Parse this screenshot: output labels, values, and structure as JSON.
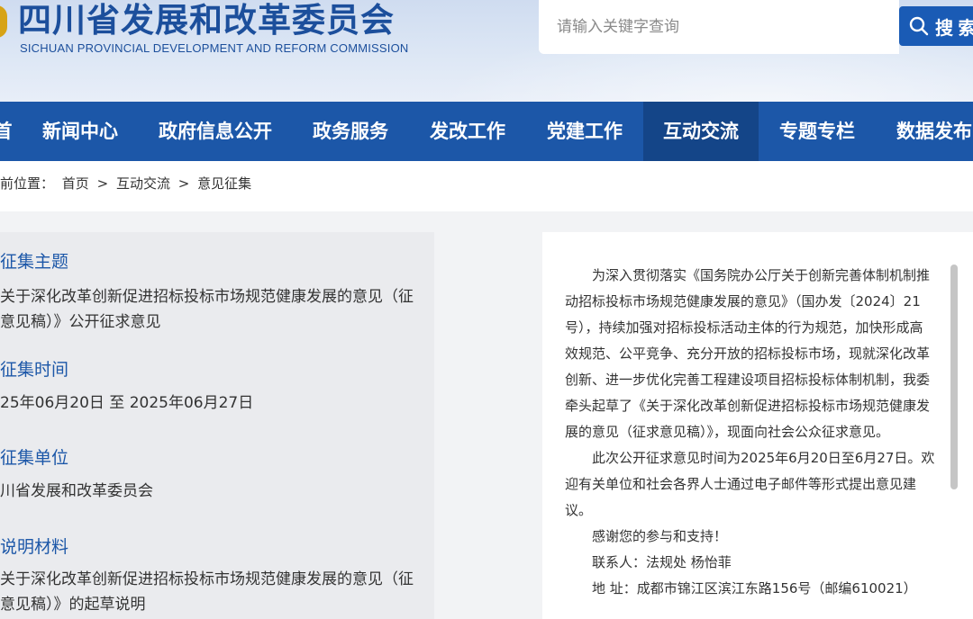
{
  "header": {
    "title": "四川省发展和改革委员会",
    "subtitle": "SICHUAN PROVINCIAL DEVELOPMENT AND REFORM COMMISSION",
    "search_placeholder": "请输入关键字查询",
    "search_label": "搜 索",
    "brand_color": "#1c57a8"
  },
  "nav": {
    "items": [
      {
        "label": "首"
      },
      {
        "label": "新闻中心"
      },
      {
        "label": "政府信息公开"
      },
      {
        "label": "政务服务"
      },
      {
        "label": "发改工作"
      },
      {
        "label": "党建工作"
      },
      {
        "label": "互动交流"
      },
      {
        "label": "专题专栏"
      },
      {
        "label": "数据发布"
      }
    ],
    "active": "互动交流"
  },
  "breadcrumb": {
    "prefix": "前位置：",
    "items": [
      "首页",
      "互动交流",
      "意见征集"
    ],
    "separator": ">"
  },
  "info": {
    "topic_title": "征集主题",
    "topic_value": "关于深化改革创新促进招标投标市场规范健康发展的意见（征意见稿）》公开征求意见",
    "time_title": "征集时间",
    "time_value": "25年06月20日 至 2025年06月27日",
    "unit_title": "征集单位",
    "unit_value": "川省发展和改革委员会",
    "material_title": "说明材料",
    "material_value": "关于深化改革创新促进招标投标市场规范健康发展的意见（征意见稿）》的起草说明"
  },
  "article": {
    "paragraphs": [
      "为深入贯彻落实《国务院办公厅关于创新完善体制机制推动招标投标市场规范健康发展的意见》（国办发〔2024〕21号），持续加强对招标投标活动主体的行为规范，加快形成高效规范、公平竞争、充分开放的招标投标市场，现就深化改革创新、进一步优化完善工程建设项目招标投标体制机制，我委牵头起草了《关于深化改革创新促进招标投标市场规范健康发展的意见（征求意见稿）》，现面向社会公众征求意见。",
      "此次公开征求意见时间为2025年6月20日至6月27日。欢迎有关单位和社会各界人士通过电子邮件等形式提出意见建议。",
      "感谢您的参与和支持！",
      "联系人：法规处 杨怡菲",
      "地 址：成都市锦江区滨江东路156号（邮编610021）"
    ]
  }
}
